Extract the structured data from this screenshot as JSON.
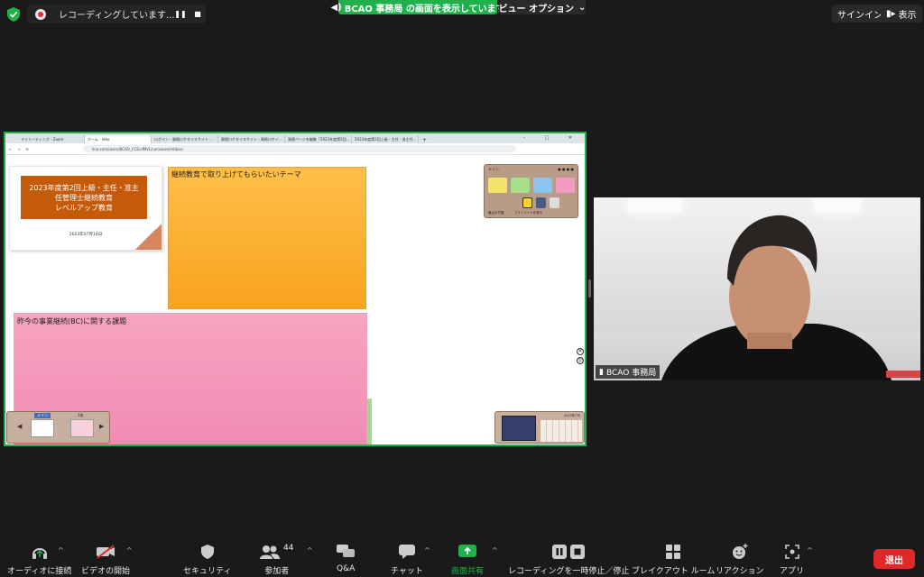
{
  "window": {
    "background": "#1a1a1a",
    "accent_green": "#21b14c",
    "leave_red": "#e02828"
  },
  "top_bar": {
    "recording_text": "レコーディングしています...",
    "sharing_banner": "BCAO 事務局 の画面を表示しています",
    "view_options_label": "ビュー オプション",
    "signin_label": "サインイン",
    "display_label": "表示"
  },
  "shared_screen": {
    "browser": {
      "tabs": [
        "マイミーティング - Zoom",
        "ホーム - Ideo",
        "ログイン - 資格ロケタイスサイト ...",
        "資格ロケタイスサイト - 資格ロケイ...",
        "資格ページを編集「2023年度第2回...",
        "2023年度第2回上級・主任・准主任..."
      ],
      "address": "lino.com/users/BCAO_CCEcdMVL/canvases/relibosi"
    },
    "title_card": {
      "lines": [
        "2023年度第2回上級・主任・准主",
        "任管理士継続教育",
        "レベルアップ教育"
      ],
      "date": "2023年07月14日"
    },
    "sticky_orange_text": "継続教育で取り上げてもらいたいテーマ",
    "sticky_pink_text": "昨今の事業継続(BC)に関する課題",
    "mini_panel": {
      "title": "メイン",
      "footer_left": "最近の付箋",
      "footer_right": "プライベートを表示"
    },
    "nav_panel": {
      "tab_left": "メイン",
      "tab_right": "1枚"
    },
    "calendar": {
      "month_label": "2023年7月"
    }
  },
  "video": {
    "participant_name": "BCAO 事務局"
  },
  "toolbar": {
    "audio_label": "オーディオに接続",
    "video_label": "ビデオの開始",
    "security_label": "セキュリティ",
    "participants_label": "参加者",
    "participants_count": "44",
    "qa_label": "Q&A",
    "chat_label": "チャット",
    "share_label": "画面共有",
    "recording_label": "レコーディングを一時停止／停止",
    "breakout_label": "ブレイクアウト ルーム",
    "reactions_label": "リアクション",
    "apps_label": "アプリ",
    "leave_label": "退出"
  }
}
